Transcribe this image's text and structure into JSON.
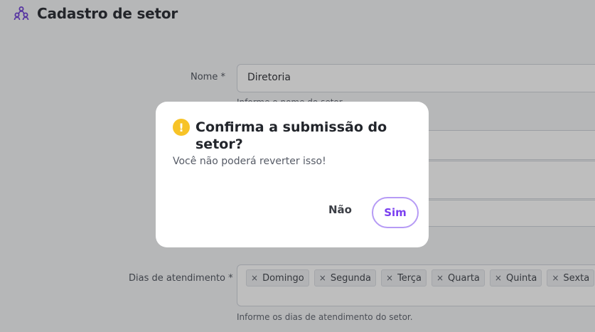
{
  "header": {
    "title": "Cadastro de setor",
    "icon": "users-group-icon"
  },
  "form": {
    "name_label": "Nome *",
    "name_value": "Diretoria",
    "name_hint": "Informe o nome do setor.",
    "days_label": "Dias de atendimento *",
    "days": [
      "Domingo",
      "Segunda",
      "Terça",
      "Quarta",
      "Quinta",
      "Sexta"
    ],
    "chip_remove_symbol": "×",
    "days_hint": "Informe os dias de atendimento do setor."
  },
  "dialog": {
    "icon": "warning-icon",
    "icon_symbol": "!",
    "title": "Confirma a submissão do setor?",
    "message": "Você não poderá reverter isso!",
    "cancel_label": "Não",
    "confirm_label": "Sim"
  },
  "colors": {
    "accent": "#7a3ff0",
    "warning": "#f7c327",
    "overlay": "rgba(40,40,40,0.30)"
  }
}
